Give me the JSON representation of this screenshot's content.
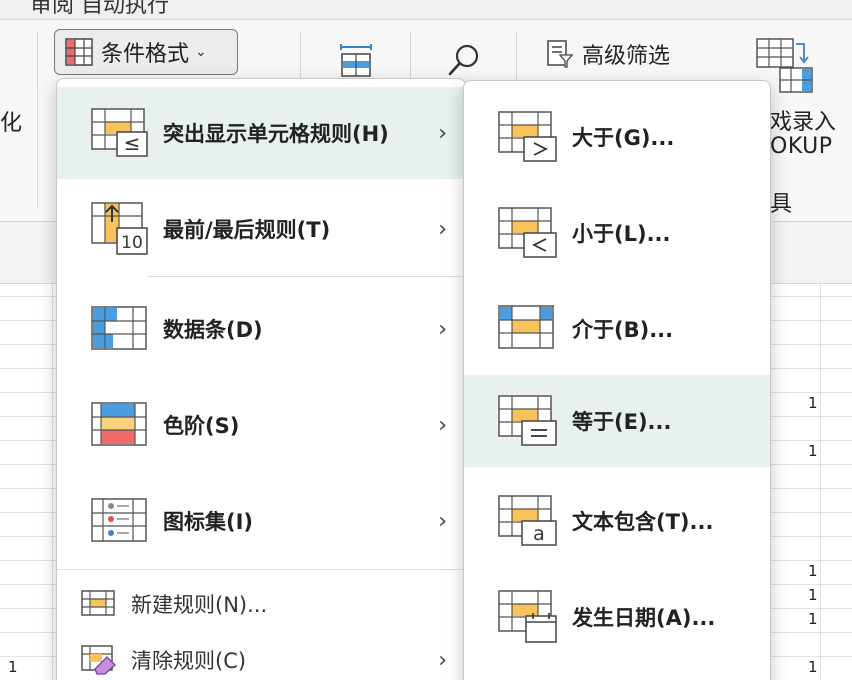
{
  "tabs": {
    "partial_text": "审阅   自动执行"
  },
  "ribbon": {
    "conditional_format_label": "条件格式",
    "advanced_filter_label": "高级筛选",
    "left_cut_label": "化",
    "lookup_line1": "戏录入",
    "lookup_line2": "OKUP",
    "group_cut_label": "具"
  },
  "main_menu": {
    "items": [
      {
        "label": "突出显示单元格规则(H)",
        "has_submenu": true,
        "icon": "highlight-cells-icon"
      },
      {
        "label": "最前/最后规则(T)",
        "has_submenu": true,
        "icon": "top-bottom-icon"
      },
      {
        "label": "数据条(D)",
        "has_submenu": true,
        "icon": "data-bars-icon"
      },
      {
        "label": "色阶(S)",
        "has_submenu": true,
        "icon": "color-scales-icon"
      },
      {
        "label": "图标集(I)",
        "has_submenu": true,
        "icon": "icon-sets-icon"
      },
      {
        "label": "新建规则(N)...",
        "has_submenu": false,
        "icon": "new-rule-icon"
      },
      {
        "label": "清除规则(C)",
        "has_submenu": true,
        "icon": "clear-rules-icon"
      }
    ]
  },
  "sub_menu": {
    "items": [
      {
        "label": "大于(G)...",
        "icon": "greater-than-icon"
      },
      {
        "label": "小于(L)...",
        "icon": "less-than-icon"
      },
      {
        "label": "介于(B)...",
        "icon": "between-icon"
      },
      {
        "label": "等于(E)...",
        "icon": "equal-to-icon"
      },
      {
        "label": "文本包含(T)...",
        "icon": "text-contains-icon"
      },
      {
        "label": "发生日期(A)...",
        "icon": "date-occurring-icon"
      }
    ]
  },
  "sheet_values": [
    "1",
    "1",
    "1",
    "1",
    "1",
    "1",
    "1"
  ],
  "colors": {
    "highlight": "#e8f1ec",
    "orange": "#f8c35a",
    "blue": "#4a9ee0",
    "red": "#ef6b6b"
  }
}
